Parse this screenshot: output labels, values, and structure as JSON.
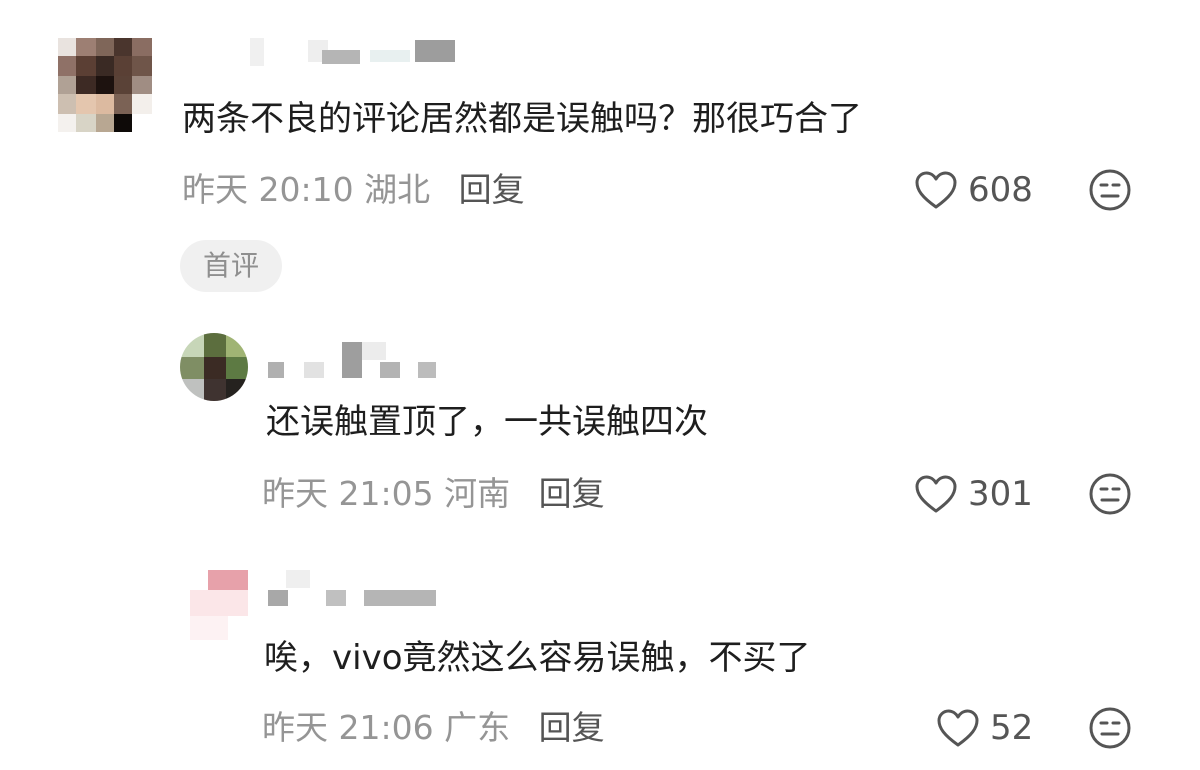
{
  "comments": [
    {
      "text": "两条不良的评论居然都是误触吗？那很巧合了",
      "time": "昨天 20:10",
      "location": "湖北",
      "reply_label": "回复",
      "likes": "608",
      "badge": "首评"
    },
    {
      "text": "还误触置顶了，一共误触四次",
      "time": "昨天 21:05",
      "location": "河南",
      "reply_label": "回复",
      "likes": "301"
    },
    {
      "text": "唉，vivo竟然这么容易误触，不买了",
      "time": "昨天 21:06",
      "location": "广东",
      "reply_label": "回复",
      "likes": "52"
    }
  ],
  "icons": {
    "like": "heart-outline-icon",
    "dislike": "neutral-face-icon"
  },
  "colors": {
    "text_primary": "#1e1e1e",
    "text_secondary": "#959595",
    "icon": "#555555",
    "badge_bg": "#f0f0f0"
  }
}
